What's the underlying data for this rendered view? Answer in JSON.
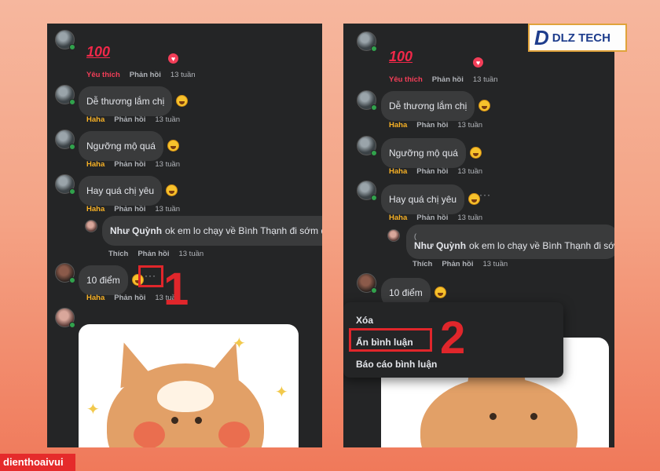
{
  "left": {
    "comments": [
      {
        "text": "Dễ thương lắm chị",
        "reaction": "Haha",
        "reply": "Phản hồi",
        "time": "13 tuần"
      },
      {
        "text": "Ngưỡng mộ quá",
        "reaction": "Haha",
        "reply": "Phản hồi",
        "time": "13 tuần"
      },
      {
        "text": "Hay quá chị yêu",
        "reaction": "Haha",
        "reply": "Phản hồi",
        "time": "13 tuần"
      },
      {
        "text": "10 điểm",
        "reaction": "Haha",
        "reply": "Phản hồi",
        "time": "13 tuần"
      }
    ],
    "top_comment": {
      "sticker_text": "100",
      "reaction": "Yêu thích",
      "reply": "Phản hồi",
      "time": "13 tuần"
    },
    "reply_comment": {
      "author": "Như Quỳnh",
      "text": "ok em lo chạy về Bình Thạnh đi sớm đi :)",
      "reaction": "Thích",
      "reply": "Phản hồi",
      "time": "13 tuần"
    },
    "more_options": "···",
    "step_label": "1"
  },
  "right": {
    "comments": [
      {
        "text": "Dễ thương lắm chị",
        "reaction": "Haha",
        "reply": "Phản hồi",
        "time": "13 tuần"
      },
      {
        "text": "Ngưỡng mộ quá",
        "reaction": "Haha",
        "reply": "Phản hồi",
        "time": "13 tuần"
      },
      {
        "text": "Hay quá chị yêu",
        "reaction": "Haha",
        "reply": "Phản hồi",
        "time": "13 tuần"
      },
      {
        "text": "10 điểm"
      }
    ],
    "top_comment": {
      "sticker_text": "100",
      "reaction": "Yêu thích",
      "reply": "Phản hồi",
      "time": "13 tuần"
    },
    "reply_comment": {
      "prefix": "(",
      "author": "Như Quỳnh",
      "text": "ok em lo chạy về Bình Thạnh đi sớm",
      "reaction": "Thích",
      "reply": "Phản hồi",
      "time": "13 tuần"
    },
    "more_options": "···",
    "menu": [
      "Xóa",
      "Ẩn bình luận",
      "Báo cáo bình luận"
    ],
    "step_label": "2"
  },
  "logo": {
    "mark": "D",
    "brand": "DLZ TECH"
  },
  "watermark": "dienthoaivui",
  "colors": {
    "highlight": "#e0262b",
    "panel": "#242526",
    "bubble": "#3a3b3c"
  }
}
